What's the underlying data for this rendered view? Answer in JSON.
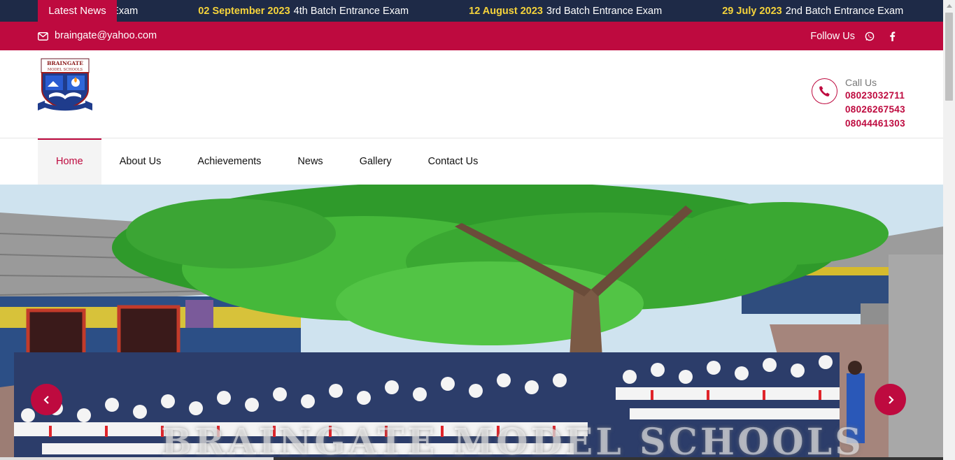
{
  "ticker": {
    "label": "Latest News",
    "items": [
      {
        "date": "",
        "text": "Batch Entrance Exam"
      },
      {
        "date": "02 September 2023",
        "text": "4th Batch Entrance Exam"
      },
      {
        "date": "12 August 2023",
        "text": "3rd Batch Entrance Exam"
      },
      {
        "date": "29 July 2023",
        "text": "2nd Batch Entrance Exam"
      }
    ]
  },
  "topbar": {
    "email": "braingate@yahoo.com",
    "email_icon": "envelope-icon",
    "follow_label": "Follow Us",
    "social_icons": [
      "whatsapp-icon",
      "facebook-icon"
    ]
  },
  "header": {
    "logo_text_top": "BRAINGATE",
    "logo_text_sub": "MODEL SCHOOLS",
    "call_label": "Call Us",
    "phones": [
      "08023032711",
      "08026267543",
      "08044461303"
    ],
    "phone_icon": "phone-icon"
  },
  "nav": {
    "items": [
      {
        "label": "Home",
        "active": true
      },
      {
        "label": "About Us",
        "active": false
      },
      {
        "label": "Achievements",
        "active": false
      },
      {
        "label": "News",
        "active": false
      },
      {
        "label": "Gallery",
        "active": false
      },
      {
        "label": "Contact Us",
        "active": false
      }
    ]
  },
  "hero": {
    "overlay_text": "BRAINGATE MODEL SCHOOLS",
    "slide_progress": 0.29
  },
  "colors": {
    "brand": "#be0a3f",
    "ticker_bg": "#1e2a47",
    "ticker_date": "#f5d33b"
  }
}
